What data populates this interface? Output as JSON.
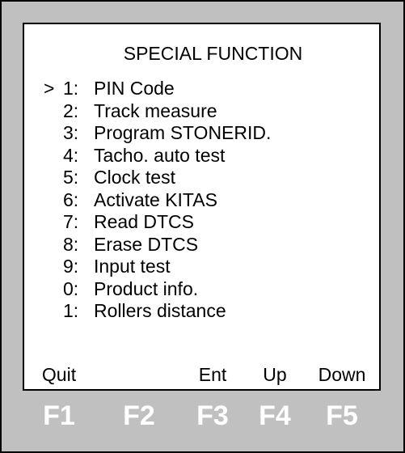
{
  "screen": {
    "title": "SPECIAL FUNCTION",
    "cursor": ">",
    "menu": [
      {
        "num": "1:",
        "label": "PIN Code",
        "selected": true
      },
      {
        "num": "2:",
        "label": "Track measure"
      },
      {
        "num": "3:",
        "label": "Program STONERID."
      },
      {
        "num": "4:",
        "label": "Tacho. auto test"
      },
      {
        "num": "5:",
        "label": "Clock test"
      },
      {
        "num": "6:",
        "label": "Activate KITAS"
      },
      {
        "num": "7:",
        "label": "Read DTCS"
      },
      {
        "num": "8:",
        "label": "Erase DTCS"
      },
      {
        "num": "9:",
        "label": "Input test"
      },
      {
        "num": "0:",
        "label": "Product info."
      },
      {
        "num": "1:",
        "label": "Rollers distance"
      }
    ],
    "softkeys": [
      "Quit",
      "",
      "Ent",
      "Up",
      "Down"
    ]
  },
  "function_keys": [
    "F1",
    "F2",
    "F3",
    "F4",
    "F5"
  ],
  "colors": {
    "bezel": "#c0c0c0",
    "screen": "#ffffff",
    "key_text": "#ffffff"
  }
}
